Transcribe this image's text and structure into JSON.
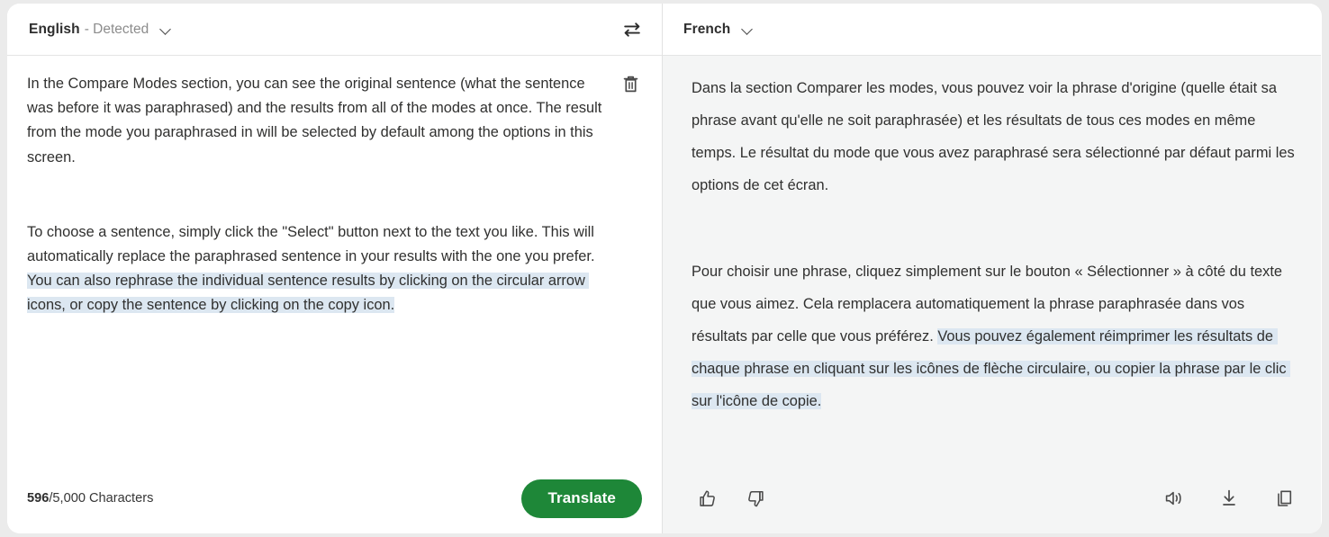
{
  "source": {
    "language": "English",
    "detected_label": "- Detected",
    "dropdown_icon": "chevron-down-icon",
    "delete_icon": "trash-icon",
    "paragraph_1": "In the Compare Modes section, you can see the original sentence (what the sentence was before it was paraphrased) and the results from all of the modes at once. The result from the mode you paraphrased in will be selected by default among the options in this screen.",
    "paragraph_2_plain": "To choose a sentence, simply click the \"Select\" button next to the text you like. This will automatically replace the paraphrased sentence in your results with the one you prefer. ",
    "paragraph_2_highlighted": "You can also rephrase the individual sentence results by clicking on the circular arrow icons, or copy the sentence by clicking on the copy icon.",
    "char_count_current": "596",
    "char_count_rest": "/5,000 Characters",
    "translate_button": "Translate"
  },
  "swap": {
    "icon": "swap-arrows-icon"
  },
  "target": {
    "language": "French",
    "dropdown_icon": "chevron-down-icon",
    "paragraph_1": "Dans la section Comparer les modes, vous pouvez voir la phrase d'origine (quelle était sa phrase avant qu'elle ne soit paraphrasée) et les résultats de tous ces modes en même temps. Le résultat du mode que vous avez paraphrasé sera sélectionné par défaut parmi les options de cet écran.",
    "paragraph_2_plain": "Pour choisir une phrase, cliquez simplement sur le bouton « Sélectionner » à côté du texte que vous aimez. Cela remplacera automatiquement la phrase paraphrasée dans vos résultats par celle que vous préférez. ",
    "paragraph_2_highlighted": "Vous pouvez également réimprimer les résultats de chaque phrase en cliquant sur les icônes de flèche circulaire, ou copier la phrase par le clic sur l'icône de copie.",
    "thumbs_up_icon": "thumbs-up-icon",
    "thumbs_down_icon": "thumbs-down-icon",
    "listen_icon": "speaker-icon",
    "download_icon": "download-icon",
    "copy_icon": "copy-icon"
  },
  "colors": {
    "accent_green": "#1e8738",
    "highlight": "#dce7f1",
    "page_background": "#ebebeb",
    "target_panel_background": "#f4f5f5",
    "text": "#30302f"
  }
}
